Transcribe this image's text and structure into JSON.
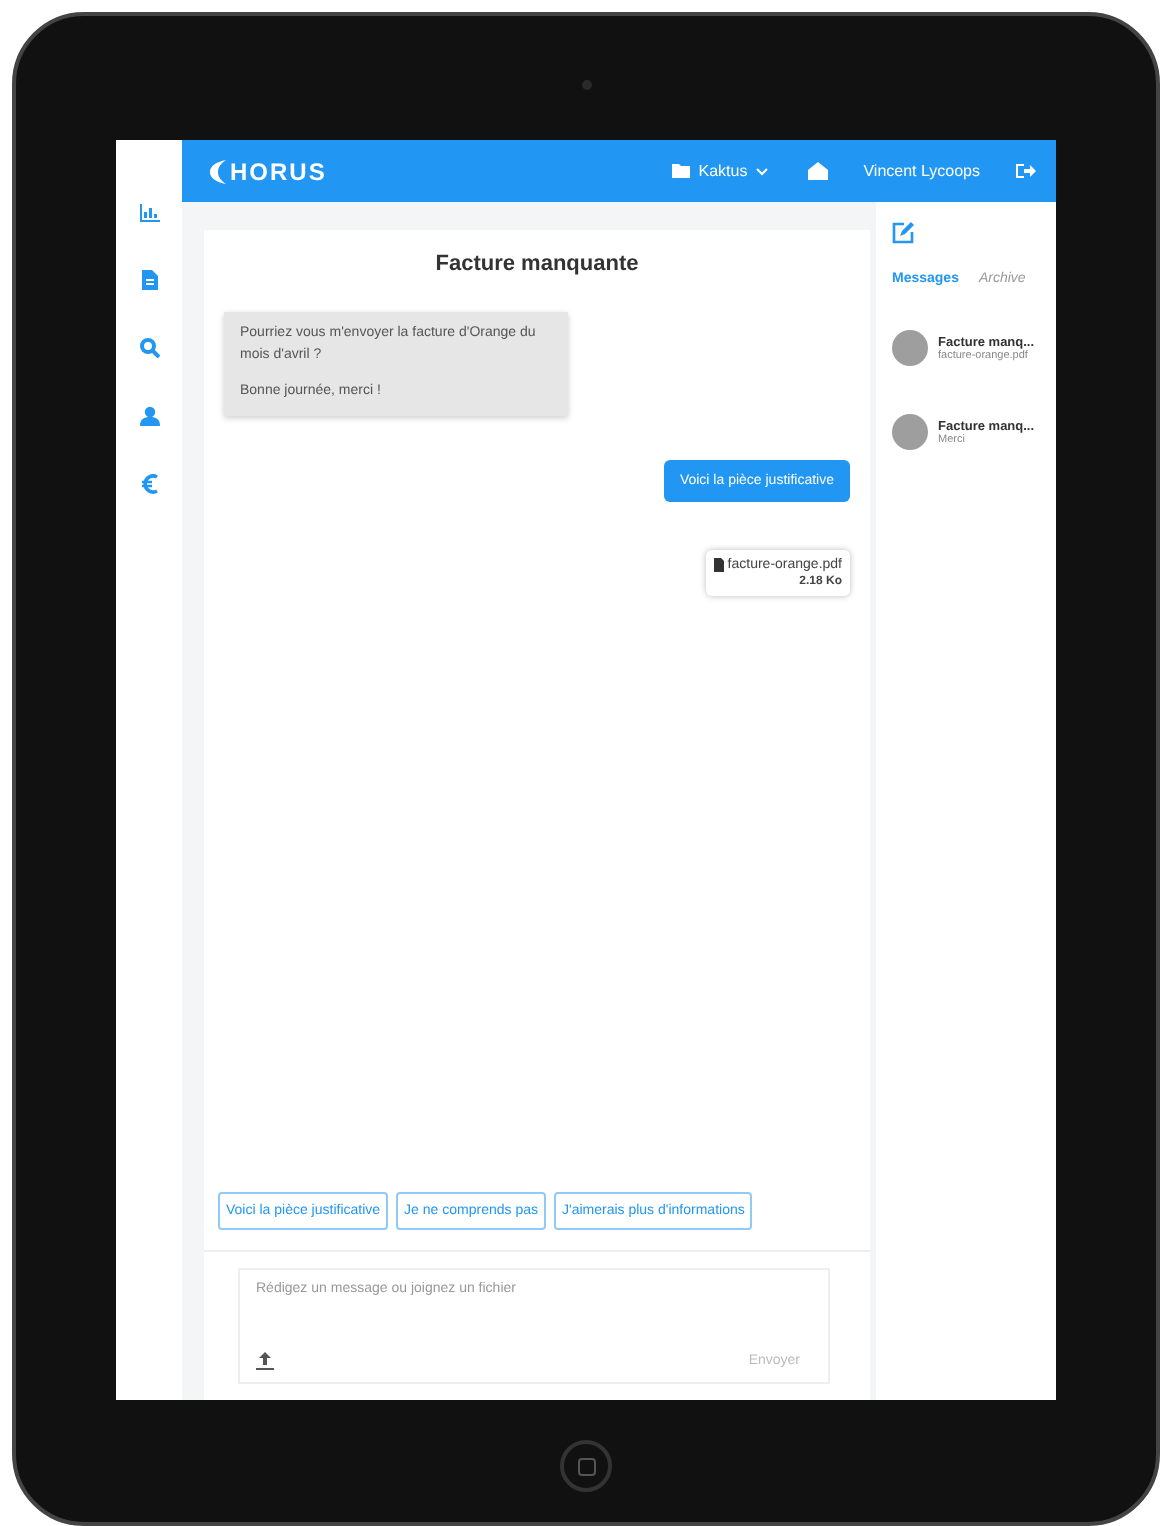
{
  "header": {
    "logo": "HORUS",
    "company": "Kaktus",
    "user": "Vincent Lycoops"
  },
  "sidebar": {
    "items": [
      {
        "kind": "chart",
        "selected": false
      },
      {
        "kind": "document",
        "selected": false
      },
      {
        "kind": "search",
        "selected": false
      },
      {
        "kind": "user",
        "selected": false
      },
      {
        "kind": "euro",
        "selected": false
      }
    ]
  },
  "chat": {
    "title": "Facture manquante",
    "messages": [
      {
        "kind": "incoming",
        "lines": [
          "Pourriez vous m'envoyer la facture d'Orange du mois d'avril ?",
          "Bonne journée, merci !"
        ]
      },
      {
        "kind": "outgoing",
        "lines": [
          "Voici la pièce justificative"
        ]
      },
      {
        "kind": "file",
        "lines": [
          "facture-orange.pdf",
          "2.18 Ko"
        ]
      }
    ],
    "quick_replies": [
      "Voici la pièce justificative",
      "Je ne comprends pas",
      "J'aimerais plus d'informations"
    ],
    "composer": {
      "placeholder": "Rédigez un message ou joignez un fichier",
      "send": "Envoyer"
    }
  },
  "conversations": {
    "tabs": [
      {
        "label": "Messages",
        "selected": true
      },
      {
        "label": "Archive",
        "selected": false
      }
    ],
    "items": [
      {
        "title": "Facture manq...",
        "preview": "facture-orange.pdf"
      },
      {
        "title": "Facture manq...",
        "preview": "Merci"
      }
    ]
  }
}
